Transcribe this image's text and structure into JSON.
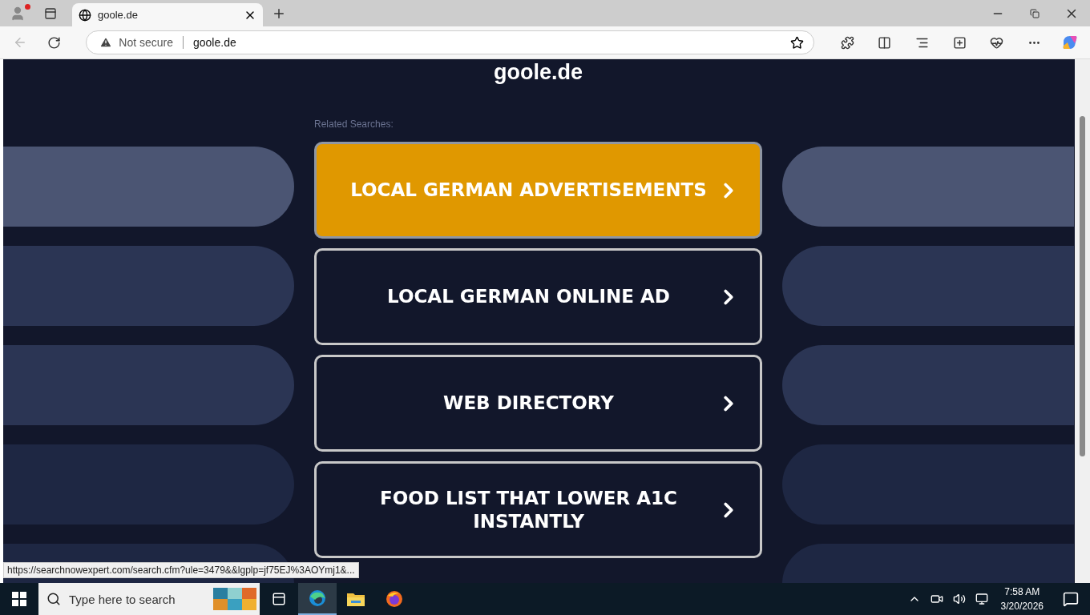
{
  "browser": {
    "tab": {
      "title": "goole.de"
    },
    "address_bar": {
      "security": "Not secure",
      "url": "goole.de"
    }
  },
  "page": {
    "heading": "goole.de",
    "related_label": "Related Searches:",
    "searches": [
      {
        "label": "LOCAL GERMAN ADVERTISEMENTS",
        "selected": true
      },
      {
        "label": "LOCAL GERMAN ONLINE AD",
        "selected": false
      },
      {
        "label": "WEB DIRECTORY",
        "selected": false
      },
      {
        "label": "FOOD LIST THAT LOWER A1C INSTANTLY",
        "selected": false
      }
    ]
  },
  "status_link": "https://searchnowexpert.com/search.cfm?ule=3479&&lgplp=jf75EJ%3AOYmj1&...",
  "taskbar": {
    "search_placeholder": "Type here to search",
    "time": "7:58 AM",
    "date": "3/20/2026"
  }
}
